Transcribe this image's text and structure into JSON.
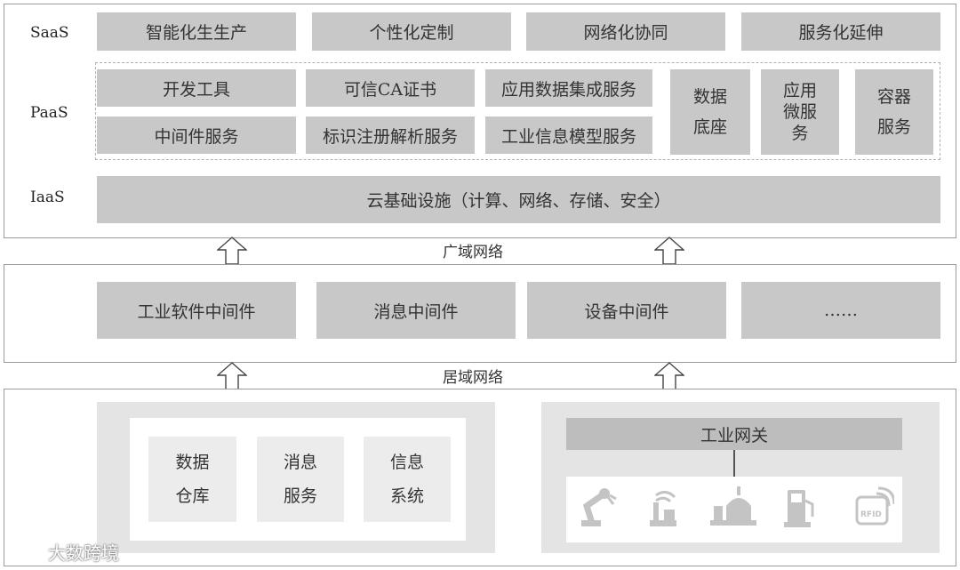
{
  "layers": {
    "saas": {
      "label": "SaaS",
      "items": [
        "智能化生生产",
        "个性化定制",
        "网络化协同",
        "服务化延伸"
      ]
    },
    "paas": {
      "label": "PaaS",
      "grid": [
        "开发工具",
        "可信CA证书",
        "应用数据集成服务",
        "中间件服务",
        "标识注册解析服务",
        "工业信息模型服务"
      ],
      "tall": [
        [
          "数据",
          "底座"
        ],
        [
          "应用",
          "微服",
          "务"
        ],
        [
          "容器",
          "服务"
        ]
      ]
    },
    "iaas": {
      "label": "IaaS",
      "item": "云基础设施（计算、网络、存储、安全）"
    }
  },
  "networks": {
    "wan": "广域网络",
    "lan": "居域网络"
  },
  "middleware": [
    "工业软件中间件",
    "消息中间件",
    "设备中间件",
    "……"
  ],
  "edge": {
    "left_items": [
      [
        "数据",
        "仓库"
      ],
      [
        "消息",
        "服务"
      ],
      [
        "信息",
        "系统"
      ]
    ],
    "gateway": "工业网关",
    "devices": [
      "robot-arm-icon",
      "antenna-icon",
      "tank-icon",
      "pump-icon",
      "rfid-icon"
    ],
    "rfid_text": "RFID"
  },
  "watermark": "大数跨境"
}
